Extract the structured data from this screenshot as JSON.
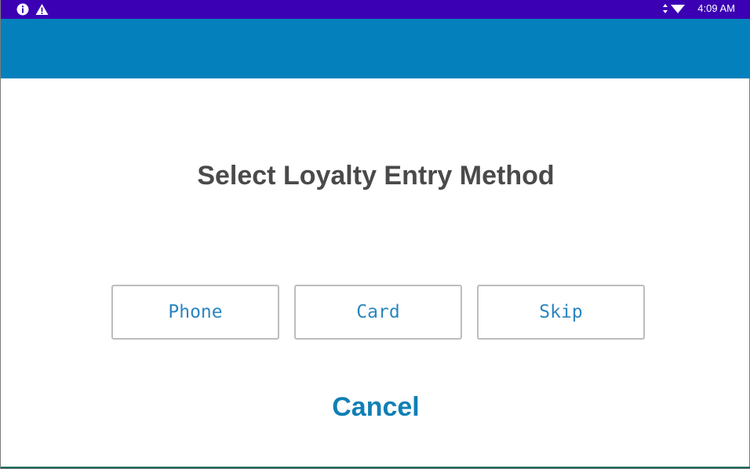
{
  "status_bar": {
    "left_icons": [
      "info-icon",
      "warning-icon"
    ],
    "right_icons": [
      "data-transfer-icon",
      "wifi-icon"
    ],
    "time": "4:09 AM",
    "background": "#3c00b4"
  },
  "toolbar": {
    "background": "#0480bc"
  },
  "dialog": {
    "title": "Select Loyalty Entry Method",
    "options": [
      {
        "label": "Phone"
      },
      {
        "label": "Card"
      },
      {
        "label": "Skip"
      }
    ],
    "cancel_label": "Cancel",
    "accent_color": "#0f7fb5"
  }
}
